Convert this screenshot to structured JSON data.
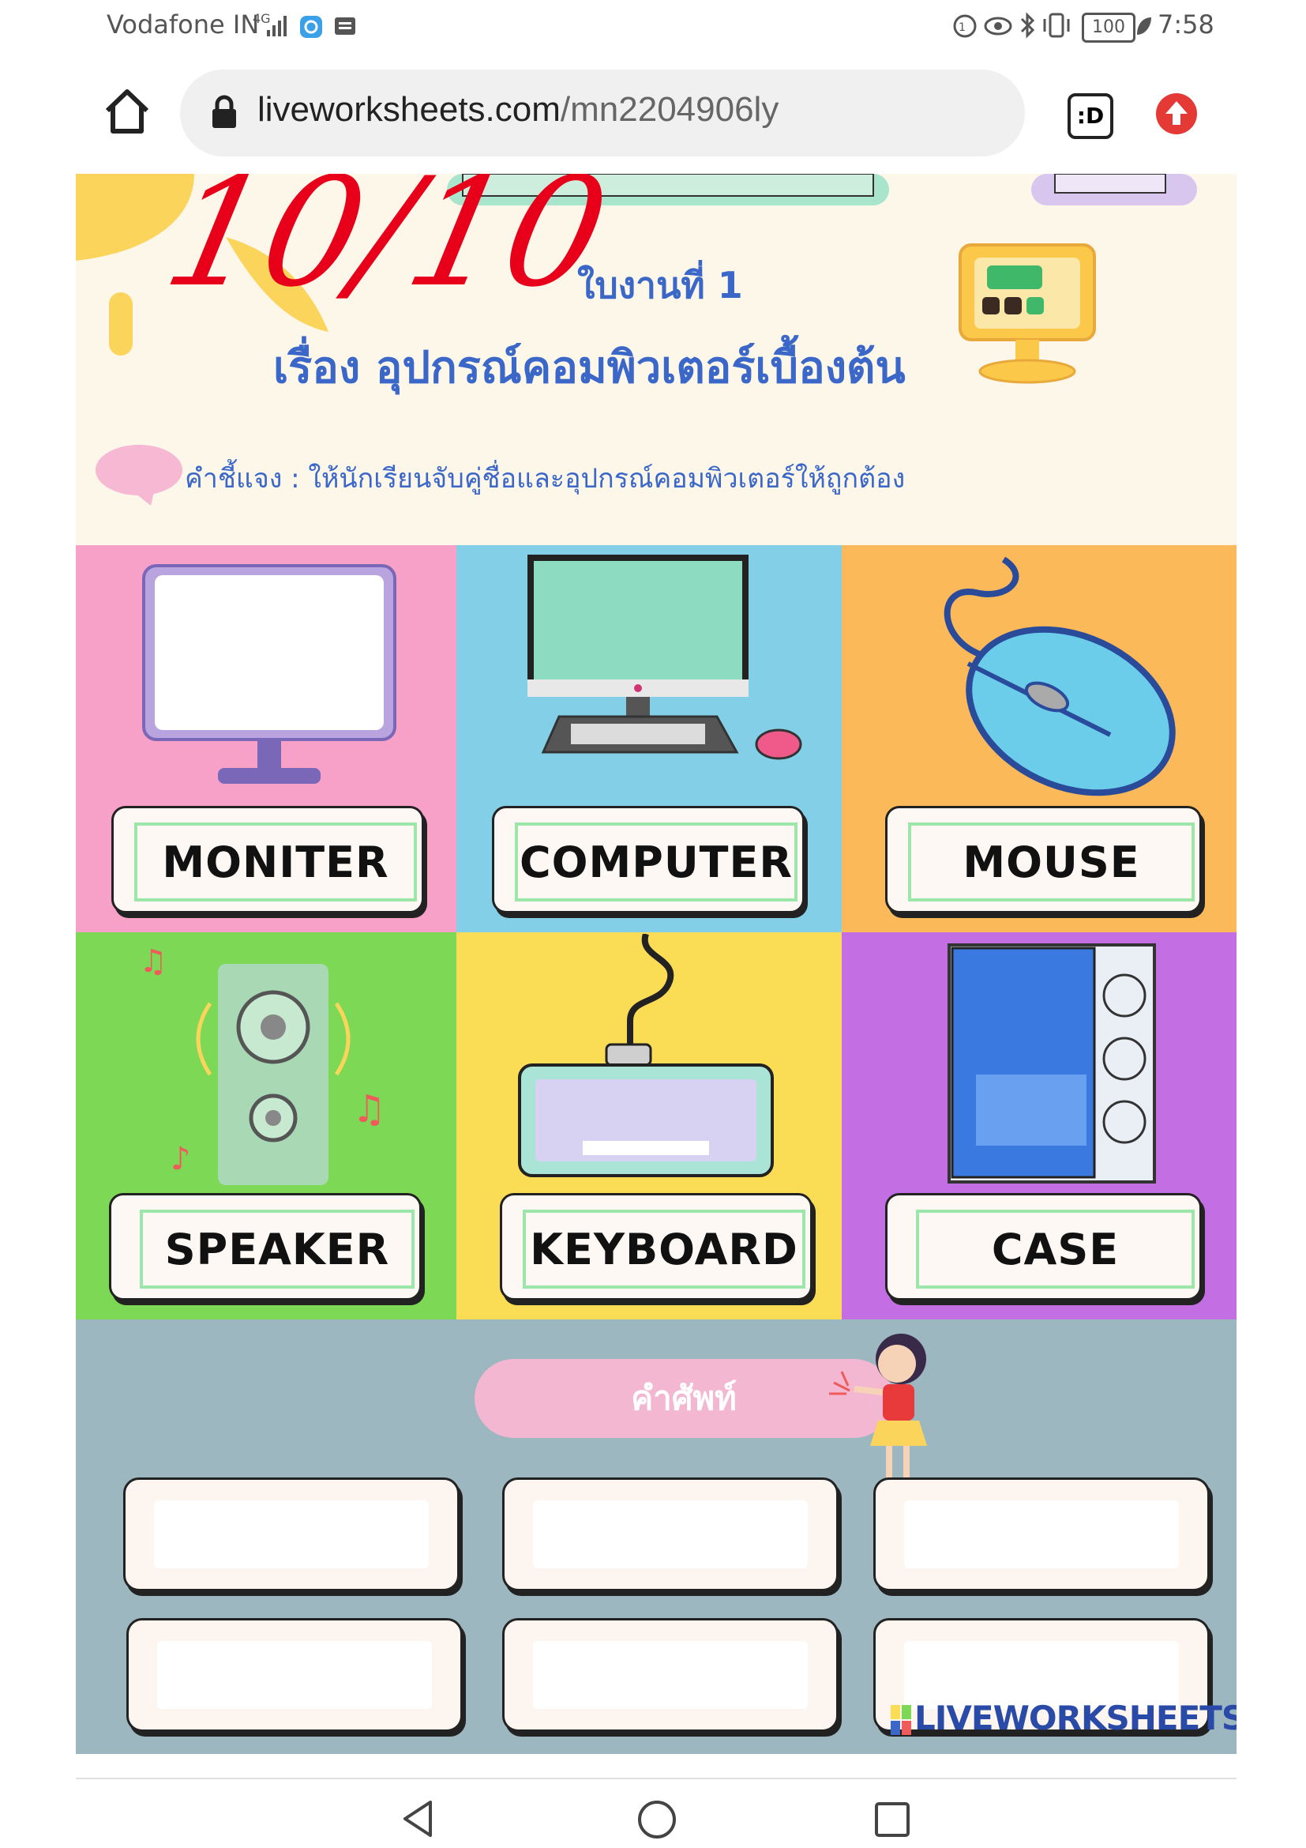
{
  "status_bar": {
    "carrier": "Vodafone IN",
    "network": "4G",
    "battery": "100",
    "time": "7:58"
  },
  "browser": {
    "url_host": "liveworksheets.com",
    "url_path": "/mn2204906ly",
    "tab_count": ":D"
  },
  "worksheet": {
    "score": "10/10",
    "sheet_number": "ใบงานที่ 1",
    "title": "เรื่อง อุปกรณ์คอมพิวเตอร์เบื้องต้น",
    "instruction": "คำชี้แจง : ให้นักเรียนจับคู่ชื่อและอุปกรณ์คอมพิวเตอร์ให้ถูกต้อง",
    "items": [
      {
        "label": "MONITER",
        "color": "#f7a1c8"
      },
      {
        "label": "COMPUTER",
        "color": "#84cfe8"
      },
      {
        "label": "MOUSE",
        "color": "#fbb95a"
      },
      {
        "label": "SPEAKER",
        "color": "#7dd955"
      },
      {
        "label": "KEYBOARD",
        "color": "#fbdd55"
      },
      {
        "label": "CASE",
        "color": "#c36ee2"
      }
    ],
    "vocab_title": "คำศัพท์",
    "brand": "LIVEWORKSHEETS",
    "colors": {
      "vocab_bg": "#9cb7c0",
      "header_bg": "#fdf7ea",
      "title_blue": "#3a67c8",
      "score_red": "#e8001a"
    }
  }
}
